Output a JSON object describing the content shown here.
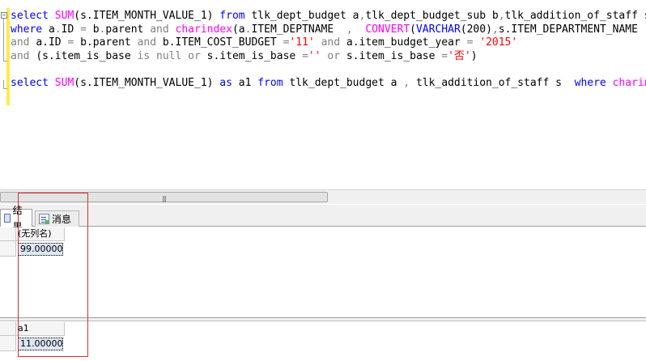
{
  "editor": {
    "lines": [
      [
        {
          "t": "select ",
          "c": "kw"
        },
        {
          "t": "SUM",
          "c": "fn"
        },
        {
          "t": "(s.ITEM_MONTH_VALUE_1) "
        },
        {
          "t": "from ",
          "c": "kw"
        },
        {
          "t": "tlk_dept_budget a"
        },
        {
          "t": ",",
          "c": "op"
        },
        {
          "t": "tlk_dept_budget_sub b"
        },
        {
          "t": ",",
          "c": "op"
        },
        {
          "t": "tlk_addition_of_staff s"
        }
      ],
      [
        {
          "t": "where ",
          "c": "kw"
        },
        {
          "t": "a"
        },
        {
          "t": ".",
          "c": "op"
        },
        {
          "t": "ID "
        },
        {
          "t": "=",
          "c": "op"
        },
        {
          "t": " b"
        },
        {
          "t": ".",
          "c": "op"
        },
        {
          "t": "parent "
        },
        {
          "t": "and ",
          "c": "op"
        },
        {
          "t": "charindex",
          "c": "fn"
        },
        {
          "t": "(a"
        },
        {
          "t": ".",
          "c": "op"
        },
        {
          "t": "ITEM_DEPTNAME  "
        },
        {
          "t": ",",
          "c": "op"
        },
        {
          "t": "  "
        },
        {
          "t": "CONVERT",
          "c": "fn"
        },
        {
          "t": "("
        },
        {
          "t": "VARCHAR",
          "c": "kw"
        },
        {
          "t": "(200)"
        },
        {
          "t": ",",
          "c": "op"
        },
        {
          "t": "s.ITEM_DEPARTMENT_NAME"
        }
      ],
      [
        {
          "t": "and ",
          "c": "op"
        },
        {
          "t": "a.ID "
        },
        {
          "t": "=",
          "c": "op"
        },
        {
          "t": " b.parent "
        },
        {
          "t": "and ",
          "c": "op"
        },
        {
          "t": "b.ITEM_COST_BUDGET "
        },
        {
          "t": "=",
          "c": "op"
        },
        {
          "t": "'11'",
          "c": "str"
        },
        {
          "t": " "
        },
        {
          "t": "and ",
          "c": "op"
        },
        {
          "t": "a.item_budget_year "
        },
        {
          "t": "=",
          "c": "op"
        },
        {
          "t": " "
        },
        {
          "t": "'2015'",
          "c": "str"
        }
      ],
      [
        {
          "t": "and ",
          "c": "op"
        },
        {
          "t": "(s.item_is_base "
        },
        {
          "t": "is null ",
          "c": "op"
        },
        {
          "t": "or ",
          "c": "op"
        },
        {
          "t": "s.item_is_base "
        },
        {
          "t": "=",
          "c": "op"
        },
        {
          "t": "''",
          "c": "str"
        },
        {
          "t": " "
        },
        {
          "t": "or ",
          "c": "op"
        },
        {
          "t": "s.item_is_base "
        },
        {
          "t": "=",
          "c": "op"
        },
        {
          "t": "'否'",
          "c": "str"
        },
        {
          "t": ")"
        }
      ],
      [],
      [
        {
          "t": "select ",
          "c": "kw"
        },
        {
          "t": "SUM",
          "c": "fn"
        },
        {
          "t": "(s.ITEM_MONTH_VALUE_1) "
        },
        {
          "t": "as ",
          "c": "kw"
        },
        {
          "t": "a1 "
        },
        {
          "t": "from ",
          "c": "kw"
        },
        {
          "t": "tlk_dept_budget a "
        },
        {
          "t": ",",
          "c": "op"
        },
        {
          "t": " tlk_addition_of_staff s  "
        },
        {
          "t": "where ",
          "c": "kw"
        },
        {
          "t": "charindex",
          "c": "fn"
        }
      ]
    ]
  },
  "tabs": {
    "results_label": "结果",
    "messages_label": "消息"
  },
  "results": [
    {
      "column": "(无列名)",
      "value": "99.00000"
    },
    {
      "column": "a1",
      "value": "11.00000"
    }
  ],
  "icons": {
    "results_tab": "grid-icon",
    "messages_tab": "message-icon"
  },
  "colors": {
    "keyword": "#0000ff",
    "function": "#ff00ff",
    "operator": "#808080",
    "string": "#ff0000",
    "annotation": "#d83030"
  }
}
